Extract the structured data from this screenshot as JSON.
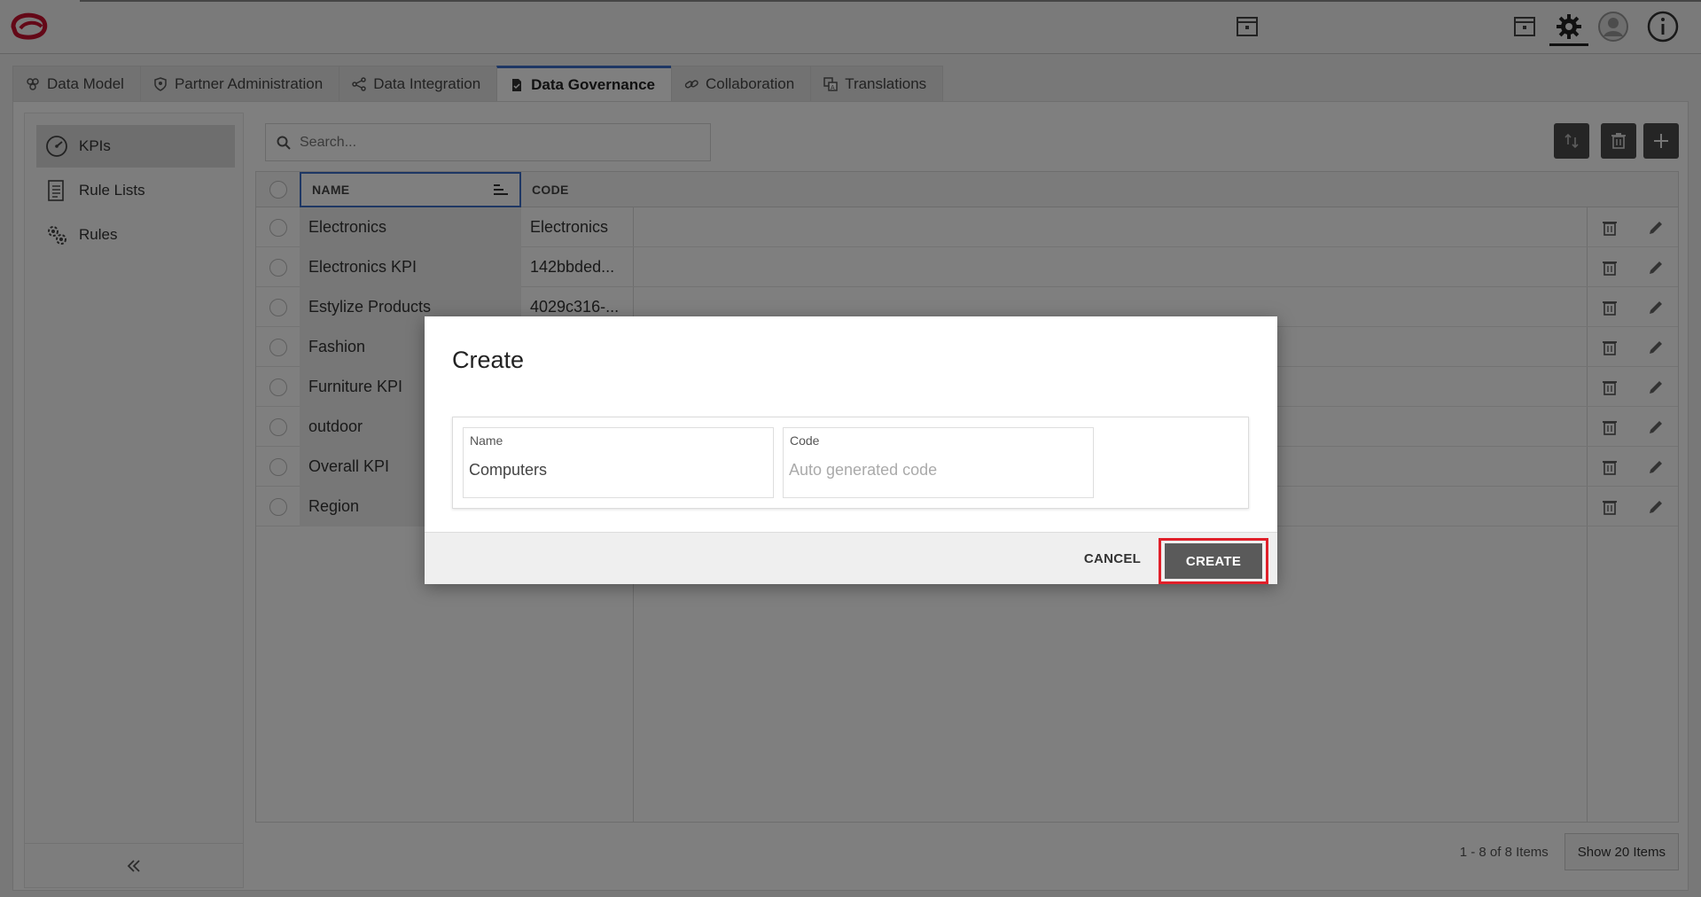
{
  "header": {
    "icons": [
      "calendar-archive-icon",
      "gear-icon",
      "user-avatar-icon",
      "info-icon"
    ]
  },
  "tabs": [
    {
      "label": "Data Model",
      "icon": "data-model-icon",
      "active": false
    },
    {
      "label": "Partner Administration",
      "icon": "shield-icon",
      "active": false
    },
    {
      "label": "Data Integration",
      "icon": "share-nodes-icon",
      "active": false
    },
    {
      "label": "Data Governance",
      "icon": "document-check-icon",
      "active": true
    },
    {
      "label": "Collaboration",
      "icon": "link-icon",
      "active": false
    },
    {
      "label": "Translations",
      "icon": "translate-icon",
      "active": false
    }
  ],
  "sidebar": {
    "items": [
      {
        "label": "KPIs",
        "icon": "speedometer-icon",
        "active": true
      },
      {
        "label": "Rule Lists",
        "icon": "list-document-icon",
        "active": false
      },
      {
        "label": "Rules",
        "icon": "gears-icon",
        "active": false
      }
    ],
    "collapse_icon": "double-chevron-left-icon"
  },
  "search": {
    "placeholder": "Search..."
  },
  "grid": {
    "columns": {
      "name": "NAME",
      "code": "CODE"
    },
    "rows": [
      {
        "name": "Electronics",
        "code": "Electronics"
      },
      {
        "name": "Electronics KPI",
        "code": "142bbded..."
      },
      {
        "name": "Estylize Products",
        "code": "4029c316-..."
      },
      {
        "name": "Fashion",
        "code": ""
      },
      {
        "name": "Furniture KPI",
        "code": ""
      },
      {
        "name": "outdoor",
        "code": ""
      },
      {
        "name": "Overall KPI",
        "code": ""
      },
      {
        "name": "Region",
        "code": ""
      }
    ]
  },
  "pager": {
    "summary": "1 - 8 of 8 Items",
    "show_label": "Show 20 Items"
  },
  "modal": {
    "title": "Create",
    "name_label": "Name",
    "name_value": "Computers",
    "code_label": "Code",
    "code_placeholder": "Auto generated code",
    "cancel_label": "CANCEL",
    "create_label": "CREATE"
  },
  "colors": {
    "accent": "#3d6ec9",
    "highlight": "#e0202a",
    "dark_button": "#4a4a4a"
  }
}
